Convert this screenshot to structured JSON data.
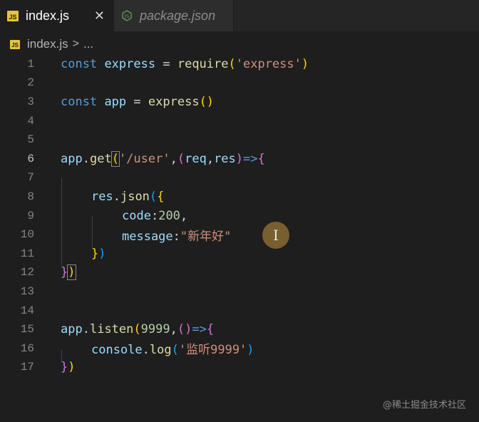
{
  "tabs": [
    {
      "label": "index.js",
      "icon": "js-file-icon",
      "active": true
    },
    {
      "label": "package.json",
      "icon": "nodejs-file-icon",
      "active": false
    }
  ],
  "js_badge": "JS",
  "close_glyph": "✕",
  "breadcrumb": {
    "file": "index.js",
    "separator": ">",
    "rest": "..."
  },
  "lines": {
    "n1": "1",
    "n2": "2",
    "n3": "3",
    "n4": "4",
    "n5": "5",
    "n6": "6",
    "n7": "7",
    "n8": "8",
    "n9": "9",
    "n10": "10",
    "n11": "11",
    "n12": "12",
    "n13": "13",
    "n14": "14",
    "n15": "15",
    "n16": "16",
    "n17": "17"
  },
  "code": {
    "l1": {
      "kw": "const",
      "var": "express",
      "op": "=",
      "fn": "require",
      "open": "(",
      "str": "'express'",
      "close": ")"
    },
    "l3": {
      "kw": "const",
      "var": "app",
      "op": "=",
      "fn": "express",
      "parens": "()"
    },
    "l6": {
      "obj": "app",
      "dot": ".",
      "fn": "get",
      "open": "(",
      "str": "'/user'",
      "comma": ",",
      "p_open": "(",
      "a1": "req",
      "c2": ",",
      "a2": "res",
      "p_close": ")",
      "arrow": "=>",
      "brace": "{"
    },
    "l8": {
      "obj": "res",
      "dot": ".",
      "fn": "json",
      "open": "(",
      "brace": "{"
    },
    "l9": {
      "key": "code",
      "colon": ":",
      "num": "200",
      "comma": ","
    },
    "l10": {
      "key": "message",
      "colon": ":",
      "str": "\"新年好\""
    },
    "l11": {
      "brace": "}",
      "close": ")"
    },
    "l12": {
      "brace": "}",
      "close": ")"
    },
    "l15": {
      "obj": "app",
      "dot": ".",
      "fn": "listen",
      "open": "(",
      "num": "9999",
      "comma": ",",
      "parens": "()",
      "arrow": "=>",
      "brace": "{"
    },
    "l16": {
      "obj": "console",
      "dot": ".",
      "fn": "log",
      "open": "(",
      "str": "'监听9999'",
      "close": ")"
    },
    "l17": {
      "brace": "}",
      "close": ")"
    }
  },
  "cursor_glyph": "I",
  "watermark": "@稀土掘金技术社区",
  "colors": {
    "keyword": "#569cd6",
    "variable": "#9cdcfe",
    "function": "#dcdcaa",
    "string": "#ce9178",
    "number": "#b5cea8"
  }
}
